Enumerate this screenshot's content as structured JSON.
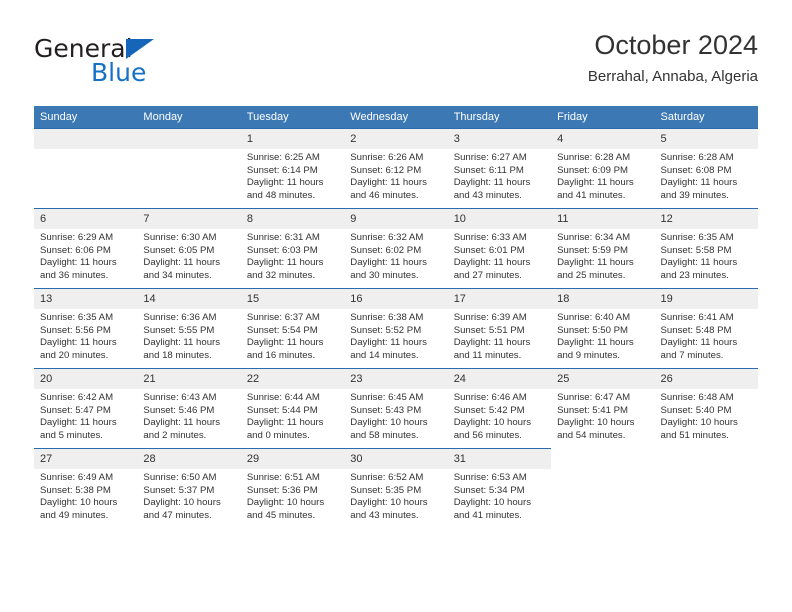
{
  "logo": {
    "part1": "General",
    "part2": "Blue",
    "triangle_color": "#1565b8",
    "blue_color": "#1572c4"
  },
  "header": {
    "title": "October 2024",
    "subtitle": "Berrahal, Annaba, Algeria"
  },
  "theme": {
    "header_bg": "#3c78b4",
    "row_border": "#2b6cad",
    "daynum_bg": "#efefef",
    "text": "#333333"
  },
  "calendar": {
    "weekday_headers": [
      "Sunday",
      "Monday",
      "Tuesday",
      "Wednesday",
      "Thursday",
      "Friday",
      "Saturday"
    ],
    "weeks": [
      [
        {
          "day": "",
          "sunrise": "",
          "sunset": "",
          "daylight1": "",
          "daylight2": ""
        },
        {
          "day": "",
          "sunrise": "",
          "sunset": "",
          "daylight1": "",
          "daylight2": ""
        },
        {
          "day": "1",
          "sunrise": "Sunrise: 6:25 AM",
          "sunset": "Sunset: 6:14 PM",
          "daylight1": "Daylight: 11 hours",
          "daylight2": "and 48 minutes."
        },
        {
          "day": "2",
          "sunrise": "Sunrise: 6:26 AM",
          "sunset": "Sunset: 6:12 PM",
          "daylight1": "Daylight: 11 hours",
          "daylight2": "and 46 minutes."
        },
        {
          "day": "3",
          "sunrise": "Sunrise: 6:27 AM",
          "sunset": "Sunset: 6:11 PM",
          "daylight1": "Daylight: 11 hours",
          "daylight2": "and 43 minutes."
        },
        {
          "day": "4",
          "sunrise": "Sunrise: 6:28 AM",
          "sunset": "Sunset: 6:09 PM",
          "daylight1": "Daylight: 11 hours",
          "daylight2": "and 41 minutes."
        },
        {
          "day": "5",
          "sunrise": "Sunrise: 6:28 AM",
          "sunset": "Sunset: 6:08 PM",
          "daylight1": "Daylight: 11 hours",
          "daylight2": "and 39 minutes."
        }
      ],
      [
        {
          "day": "6",
          "sunrise": "Sunrise: 6:29 AM",
          "sunset": "Sunset: 6:06 PM",
          "daylight1": "Daylight: 11 hours",
          "daylight2": "and 36 minutes."
        },
        {
          "day": "7",
          "sunrise": "Sunrise: 6:30 AM",
          "sunset": "Sunset: 6:05 PM",
          "daylight1": "Daylight: 11 hours",
          "daylight2": "and 34 minutes."
        },
        {
          "day": "8",
          "sunrise": "Sunrise: 6:31 AM",
          "sunset": "Sunset: 6:03 PM",
          "daylight1": "Daylight: 11 hours",
          "daylight2": "and 32 minutes."
        },
        {
          "day": "9",
          "sunrise": "Sunrise: 6:32 AM",
          "sunset": "Sunset: 6:02 PM",
          "daylight1": "Daylight: 11 hours",
          "daylight2": "and 30 minutes."
        },
        {
          "day": "10",
          "sunrise": "Sunrise: 6:33 AM",
          "sunset": "Sunset: 6:01 PM",
          "daylight1": "Daylight: 11 hours",
          "daylight2": "and 27 minutes."
        },
        {
          "day": "11",
          "sunrise": "Sunrise: 6:34 AM",
          "sunset": "Sunset: 5:59 PM",
          "daylight1": "Daylight: 11 hours",
          "daylight2": "and 25 minutes."
        },
        {
          "day": "12",
          "sunrise": "Sunrise: 6:35 AM",
          "sunset": "Sunset: 5:58 PM",
          "daylight1": "Daylight: 11 hours",
          "daylight2": "and 23 minutes."
        }
      ],
      [
        {
          "day": "13",
          "sunrise": "Sunrise: 6:35 AM",
          "sunset": "Sunset: 5:56 PM",
          "daylight1": "Daylight: 11 hours",
          "daylight2": "and 20 minutes."
        },
        {
          "day": "14",
          "sunrise": "Sunrise: 6:36 AM",
          "sunset": "Sunset: 5:55 PM",
          "daylight1": "Daylight: 11 hours",
          "daylight2": "and 18 minutes."
        },
        {
          "day": "15",
          "sunrise": "Sunrise: 6:37 AM",
          "sunset": "Sunset: 5:54 PM",
          "daylight1": "Daylight: 11 hours",
          "daylight2": "and 16 minutes."
        },
        {
          "day": "16",
          "sunrise": "Sunrise: 6:38 AM",
          "sunset": "Sunset: 5:52 PM",
          "daylight1": "Daylight: 11 hours",
          "daylight2": "and 14 minutes."
        },
        {
          "day": "17",
          "sunrise": "Sunrise: 6:39 AM",
          "sunset": "Sunset: 5:51 PM",
          "daylight1": "Daylight: 11 hours",
          "daylight2": "and 11 minutes."
        },
        {
          "day": "18",
          "sunrise": "Sunrise: 6:40 AM",
          "sunset": "Sunset: 5:50 PM",
          "daylight1": "Daylight: 11 hours",
          "daylight2": "and 9 minutes."
        },
        {
          "day": "19",
          "sunrise": "Sunrise: 6:41 AM",
          "sunset": "Sunset: 5:48 PM",
          "daylight1": "Daylight: 11 hours",
          "daylight2": "and 7 minutes."
        }
      ],
      [
        {
          "day": "20",
          "sunrise": "Sunrise: 6:42 AM",
          "sunset": "Sunset: 5:47 PM",
          "daylight1": "Daylight: 11 hours",
          "daylight2": "and 5 minutes."
        },
        {
          "day": "21",
          "sunrise": "Sunrise: 6:43 AM",
          "sunset": "Sunset: 5:46 PM",
          "daylight1": "Daylight: 11 hours",
          "daylight2": "and 2 minutes."
        },
        {
          "day": "22",
          "sunrise": "Sunrise: 6:44 AM",
          "sunset": "Sunset: 5:44 PM",
          "daylight1": "Daylight: 11 hours",
          "daylight2": "and 0 minutes."
        },
        {
          "day": "23",
          "sunrise": "Sunrise: 6:45 AM",
          "sunset": "Sunset: 5:43 PM",
          "daylight1": "Daylight: 10 hours",
          "daylight2": "and 58 minutes."
        },
        {
          "day": "24",
          "sunrise": "Sunrise: 6:46 AM",
          "sunset": "Sunset: 5:42 PM",
          "daylight1": "Daylight: 10 hours",
          "daylight2": "and 56 minutes."
        },
        {
          "day": "25",
          "sunrise": "Sunrise: 6:47 AM",
          "sunset": "Sunset: 5:41 PM",
          "daylight1": "Daylight: 10 hours",
          "daylight2": "and 54 minutes."
        },
        {
          "day": "26",
          "sunrise": "Sunrise: 6:48 AM",
          "sunset": "Sunset: 5:40 PM",
          "daylight1": "Daylight: 10 hours",
          "daylight2": "and 51 minutes."
        }
      ],
      [
        {
          "day": "27",
          "sunrise": "Sunrise: 6:49 AM",
          "sunset": "Sunset: 5:38 PM",
          "daylight1": "Daylight: 10 hours",
          "daylight2": "and 49 minutes."
        },
        {
          "day": "28",
          "sunrise": "Sunrise: 6:50 AM",
          "sunset": "Sunset: 5:37 PM",
          "daylight1": "Daylight: 10 hours",
          "daylight2": "and 47 minutes."
        },
        {
          "day": "29",
          "sunrise": "Sunrise: 6:51 AM",
          "sunset": "Sunset: 5:36 PM",
          "daylight1": "Daylight: 10 hours",
          "daylight2": "and 45 minutes."
        },
        {
          "day": "30",
          "sunrise": "Sunrise: 6:52 AM",
          "sunset": "Sunset: 5:35 PM",
          "daylight1": "Daylight: 10 hours",
          "daylight2": "and 43 minutes."
        },
        {
          "day": "31",
          "sunrise": "Sunrise: 6:53 AM",
          "sunset": "Sunset: 5:34 PM",
          "daylight1": "Daylight: 10 hours",
          "daylight2": "and 41 minutes."
        },
        {
          "day": "",
          "sunrise": "",
          "sunset": "",
          "daylight1": "",
          "daylight2": "",
          "blank": true
        },
        {
          "day": "",
          "sunrise": "",
          "sunset": "",
          "daylight1": "",
          "daylight2": "",
          "blank": true
        }
      ]
    ]
  }
}
